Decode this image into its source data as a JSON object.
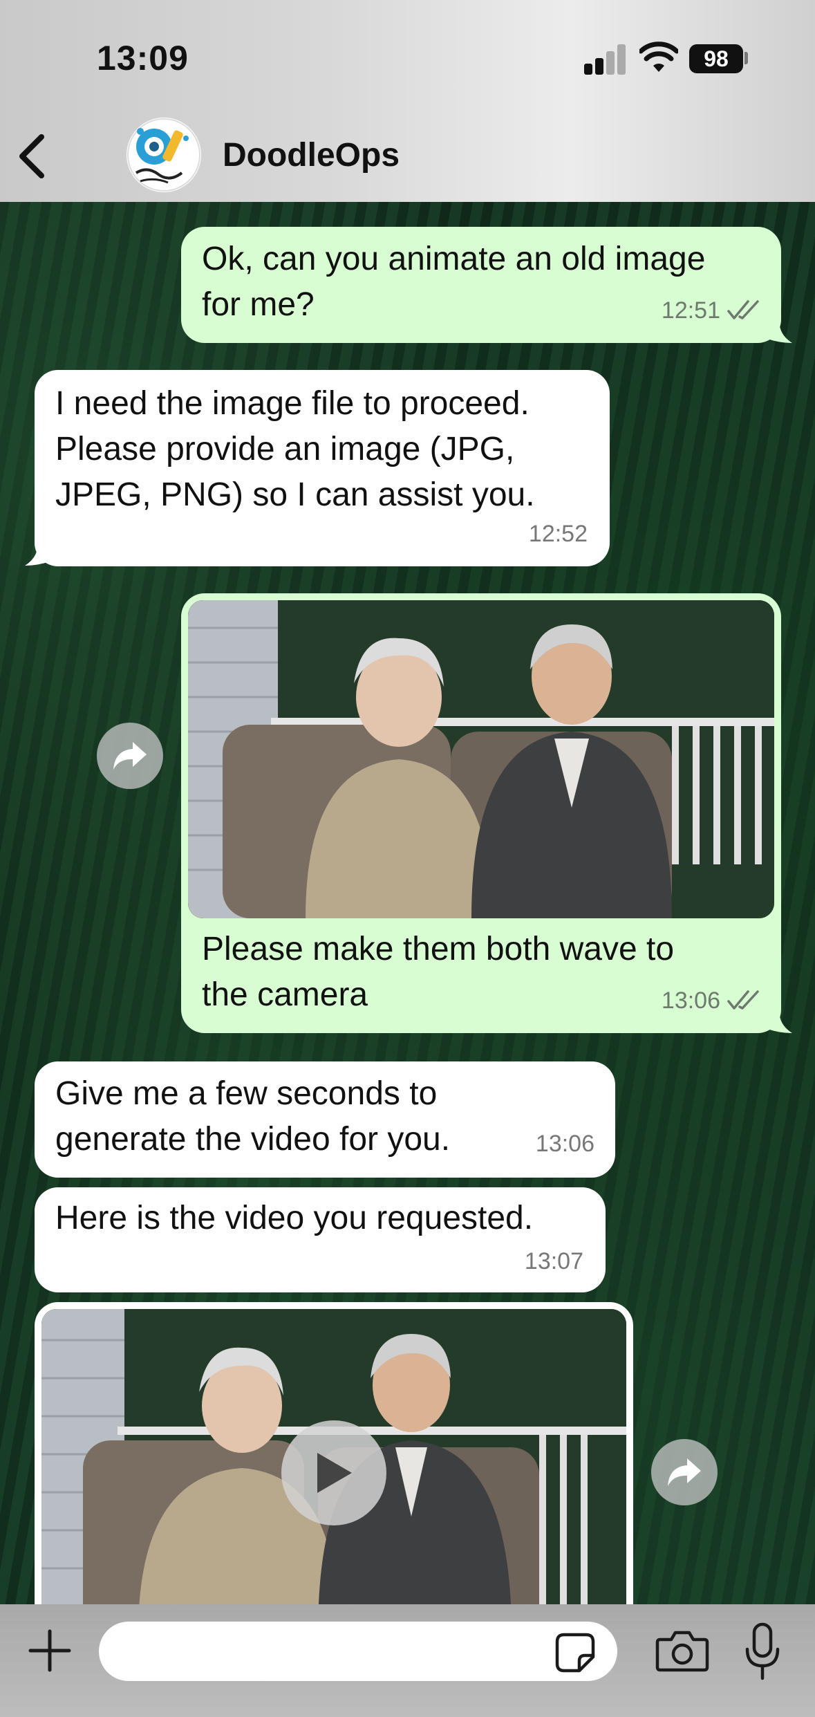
{
  "status_bar": {
    "time": "13:09",
    "battery": "98"
  },
  "header": {
    "contact_name": "DoodleOps"
  },
  "messages": [
    {
      "direction": "outgoing",
      "text_lines": [
        "Ok, can you animate an old image",
        "for me?"
      ],
      "time": "12:51",
      "read": true
    },
    {
      "direction": "incoming",
      "text_lines": [
        "I need the image file to proceed.",
        "Please provide an image (JPG,",
        "JPEG, PNG) so I can assist you."
      ],
      "time": "12:52"
    },
    {
      "direction": "outgoing",
      "has_image": true,
      "text_lines": [
        "Please make them both wave to",
        "the camera"
      ],
      "time": "13:06",
      "read": true
    },
    {
      "direction": "incoming",
      "text_lines": [
        "Give me a few seconds to",
        "generate the video for you."
      ],
      "time": "13:06"
    },
    {
      "direction": "incoming",
      "text_lines": [
        "Here is the video you requested."
      ],
      "time": "13:07"
    },
    {
      "direction": "incoming",
      "has_video": true
    }
  ],
  "composer": {
    "placeholder": ""
  },
  "icons": [
    "back-icon",
    "forward-icon",
    "play-icon",
    "plus-icon",
    "sticker-icon",
    "camera-icon",
    "microphone-icon",
    "read-receipt-icon"
  ],
  "colors": {
    "outgoing_bubble": "#d8fdd2",
    "incoming_bubble": "#ffffff",
    "read_tick": "#6d7a6d"
  }
}
